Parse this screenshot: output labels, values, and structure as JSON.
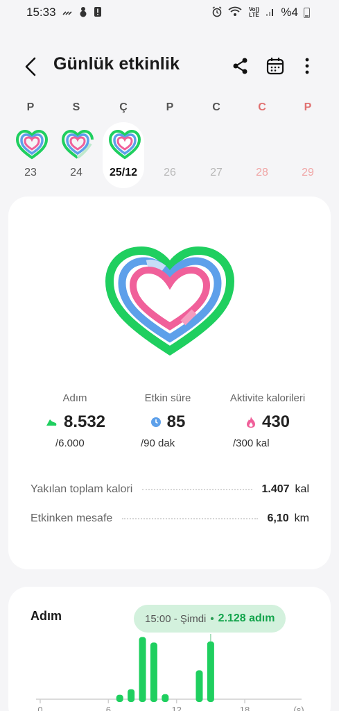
{
  "status_bar": {
    "time": "15:33",
    "volte_label": "Vo)) LTE",
    "battery_text": "%4"
  },
  "header": {
    "title": "Günlük etkinlik"
  },
  "week": [
    {
      "letter": "P",
      "number": "23",
      "state": "past"
    },
    {
      "letter": "S",
      "number": "24",
      "state": "past"
    },
    {
      "letter": "Ç",
      "number": "25/12",
      "state": "selected"
    },
    {
      "letter": "P",
      "number": "26",
      "state": "future"
    },
    {
      "letter": "C",
      "number": "27",
      "state": "future"
    },
    {
      "letter": "C",
      "number": "28",
      "state": "weekend"
    },
    {
      "letter": "P",
      "number": "29",
      "state": "weekend"
    }
  ],
  "summary": {
    "steps": {
      "label": "Adım",
      "value": "8.532",
      "goal": "/6.000"
    },
    "active_time": {
      "label": "Etkin süre",
      "value": "85",
      "goal": "/90 dak"
    },
    "activity_calories": {
      "label": "Aktivite kalorileri",
      "value": "430",
      "goal": "/300 kal"
    },
    "total_calories": {
      "label": "Yakılan toplam kalori",
      "value": "1.407",
      "unit": "kal"
    },
    "active_distance": {
      "label": "Etkinken mesafe",
      "value": "6,10",
      "unit": "km"
    }
  },
  "steps_chart": {
    "title": "Adım",
    "tooltip": {
      "time": "15:00 - Şimdi",
      "separator": "•",
      "value": "2.128 adım"
    },
    "x_tick_labels": [
      "0",
      "6",
      "12",
      "18",
      "(s)"
    ]
  },
  "colors": {
    "green": "#1fcf5f",
    "blue": "#5da0ea",
    "pink": "#f0609a",
    "weekend_red": "#e07070"
  },
  "chart_data": {
    "type": "bar",
    "x": [
      7,
      8,
      9,
      10,
      11,
      14,
      15
    ],
    "values": [
      80,
      180,
      1120,
      1020,
      90,
      520,
      1040
    ],
    "xlabel": "(s)",
    "xlim": [
      0,
      23
    ],
    "ylim": [
      0,
      1250
    ],
    "x_ticks": [
      0,
      6,
      12,
      18
    ]
  }
}
